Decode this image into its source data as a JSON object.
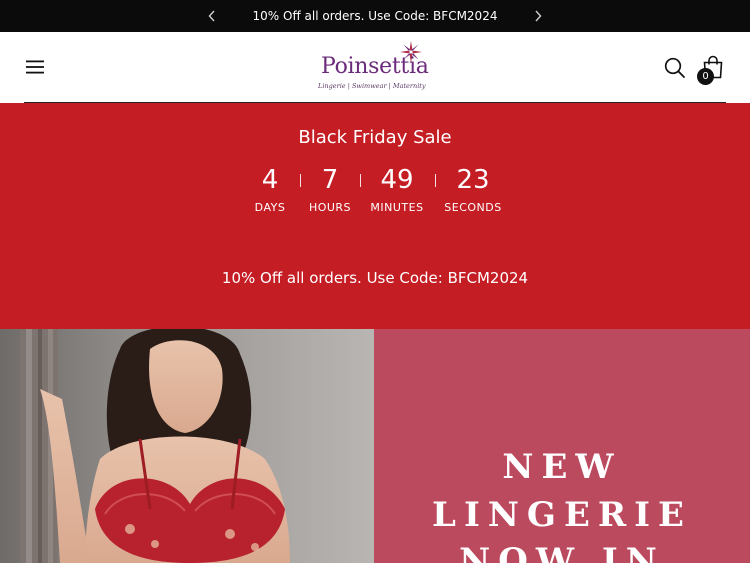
{
  "announcement": {
    "text": "10% Off all orders. Use Code: BFCM2024"
  },
  "header": {
    "logo": {
      "brand": "Poinsettia",
      "tagline": "Lingerie | Swimwear | Maternity"
    },
    "cart_count": "0"
  },
  "countdown": {
    "title": "Black Friday Sale",
    "days": "4",
    "days_label": "DAYS",
    "hours": "7",
    "hours_label": "HOURS",
    "minutes": "49",
    "minutes_label": "MINUTES",
    "seconds": "23",
    "seconds_label": "SECONDS",
    "code_text": "10% Off all orders. Use Code: BFCM2024"
  },
  "hero": {
    "line1": "NEW",
    "line2": "LINGERIE",
    "line3": "NOW IN"
  },
  "colors": {
    "announcement_bg": "#0b0b0b",
    "sale_bg": "#c51d24",
    "hero_panel_bg": "#bb4a5e",
    "brand_purple": "#6b2a7a"
  },
  "icons": {
    "prev": "chevron-left-icon",
    "next": "chevron-right-icon",
    "menu": "hamburger-menu-icon",
    "search": "search-icon",
    "cart": "shopping-bag-icon"
  }
}
